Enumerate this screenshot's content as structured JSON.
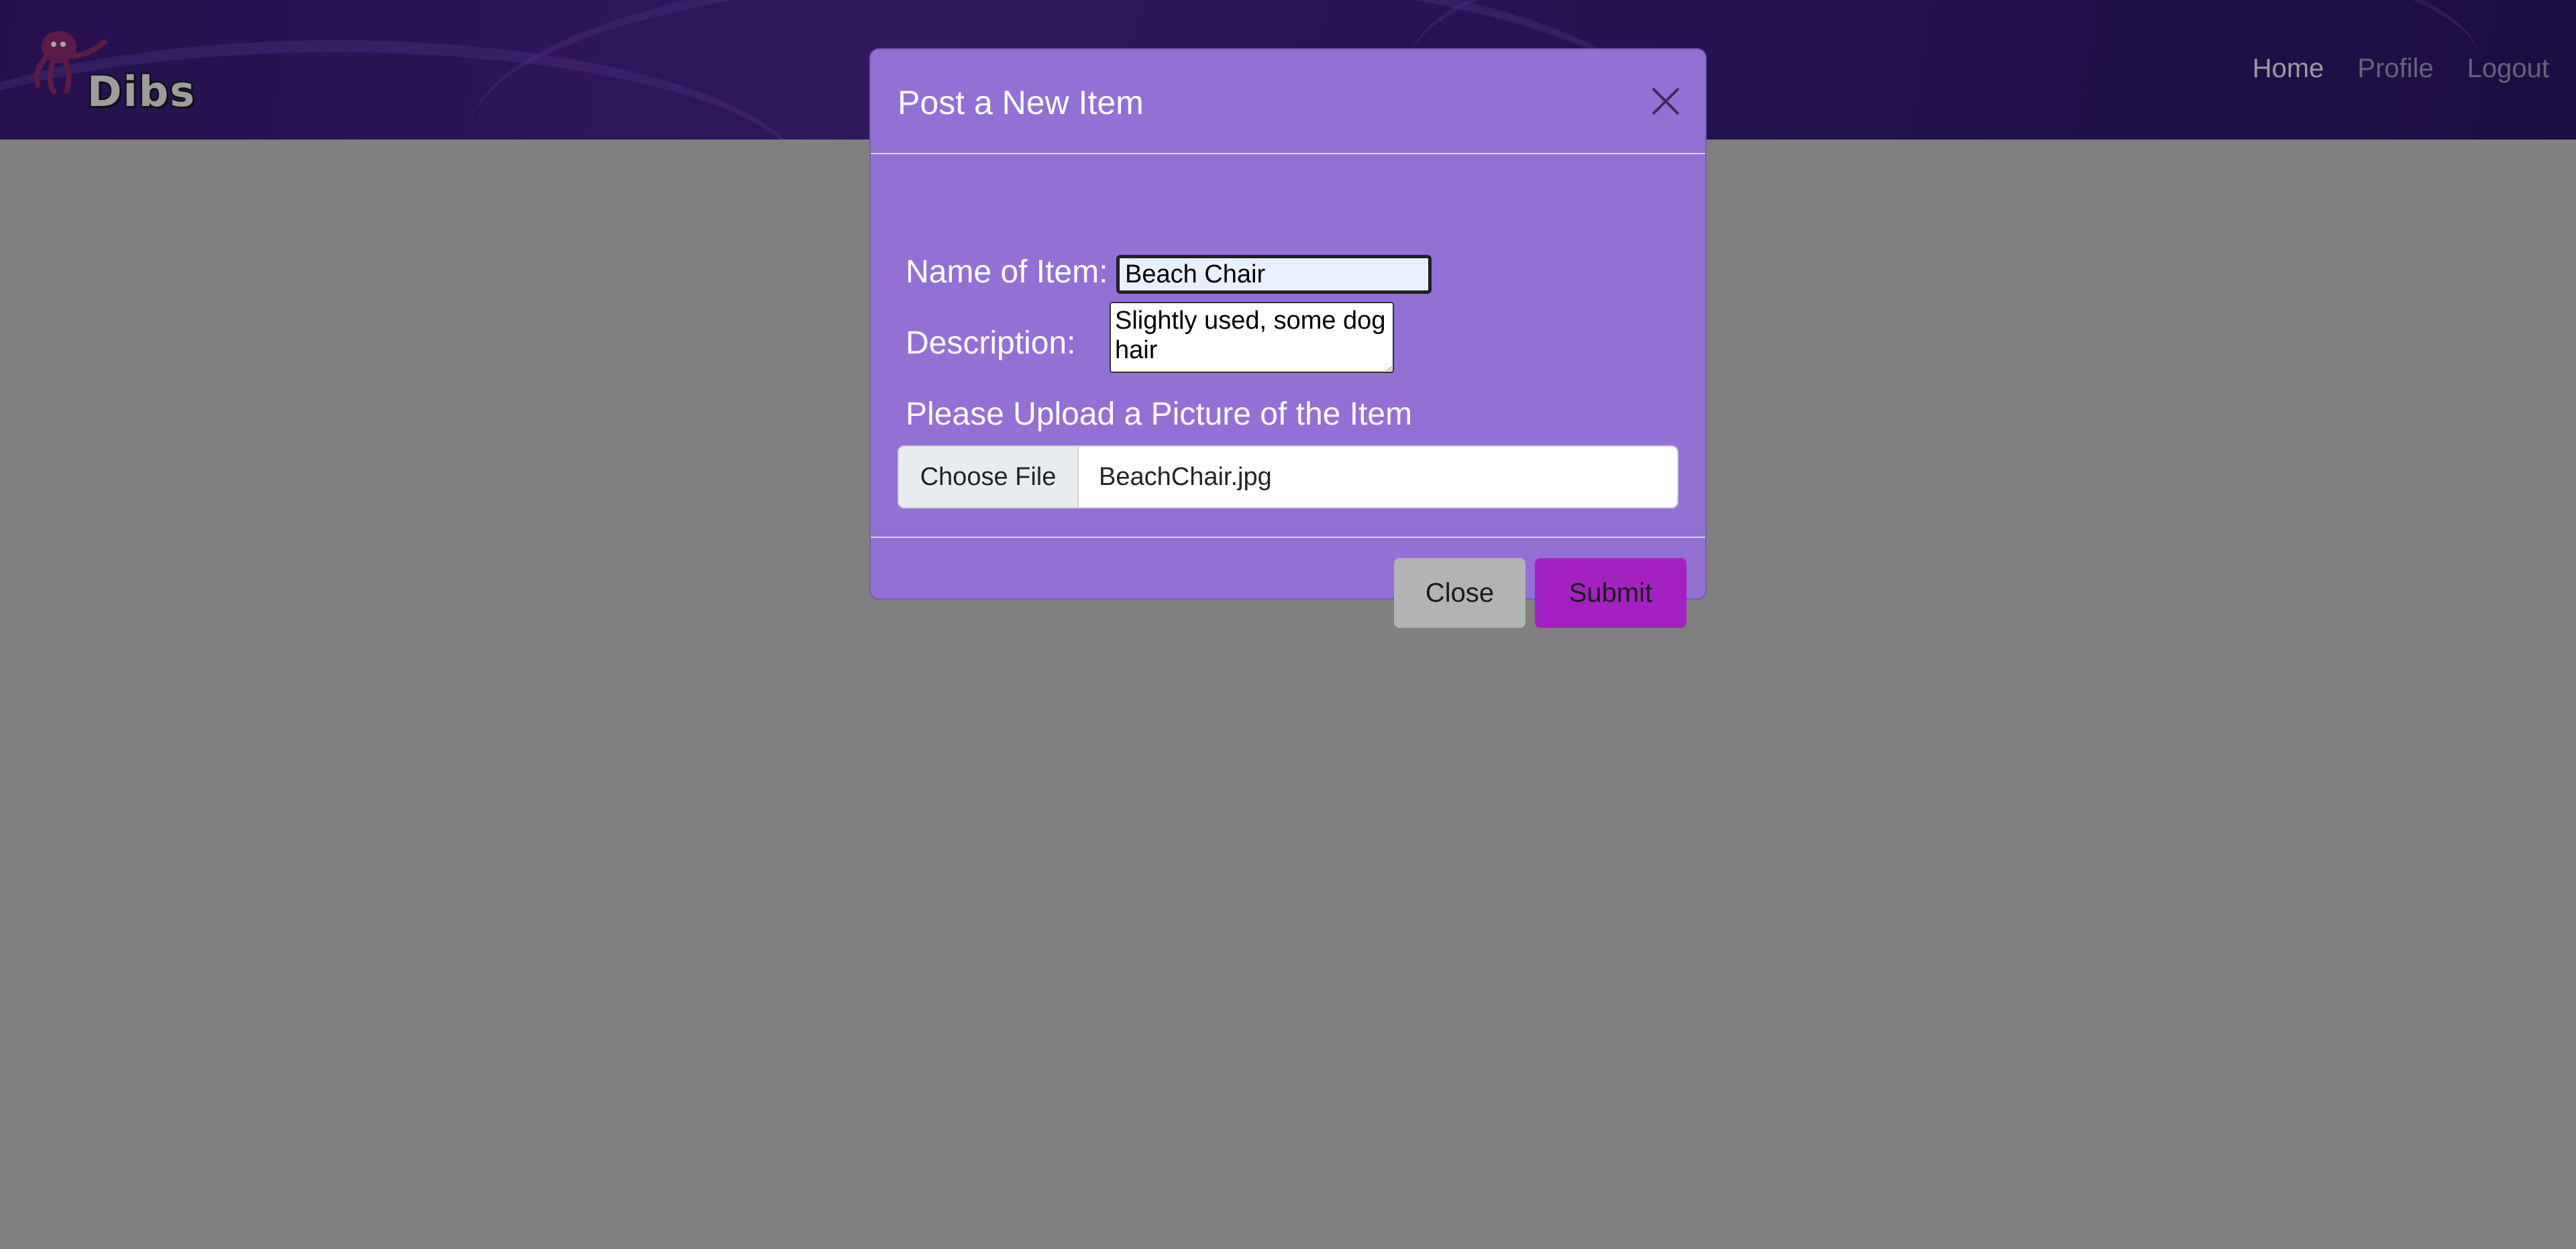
{
  "brand": {
    "logo_text": "Dibs"
  },
  "nav": {
    "items": [
      {
        "label": "Home",
        "active": true
      },
      {
        "label": "Profile",
        "active": false
      },
      {
        "label": "Logout",
        "active": false
      }
    ]
  },
  "modal": {
    "title": "Post a New Item",
    "name_label": "Name of Item:",
    "name_value": "Beach Chair",
    "description_label": "Description:",
    "description_value": "Slightly used, some dog hair",
    "upload_label": "Please Upload a Picture of the Item",
    "file_button_label": "Choose File",
    "file_name": "BeachChair.jpg",
    "close_button_label": "Close",
    "submit_button_label": "Submit"
  },
  "colors": {
    "navbar": "#3a1a7a",
    "modal_bg": "#9370d4",
    "submit_bg": "#a421c1",
    "close_bg": "#b3b3b3",
    "backdrop": "#808080"
  },
  "icons": {
    "modal_close": "close-icon",
    "logo_mascot": "octopus-icon"
  }
}
